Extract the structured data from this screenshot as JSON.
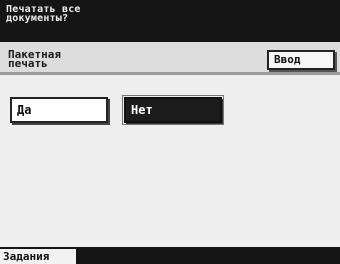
{
  "prompt": {
    "text": "Печатать все\nдокументы?"
  },
  "mode": {
    "label": "Пакетная\nпечать",
    "enter_button": "Ввод"
  },
  "choices": {
    "yes": "Да",
    "no": "Нет"
  },
  "footer": {
    "jobs_tab": "Задания"
  }
}
